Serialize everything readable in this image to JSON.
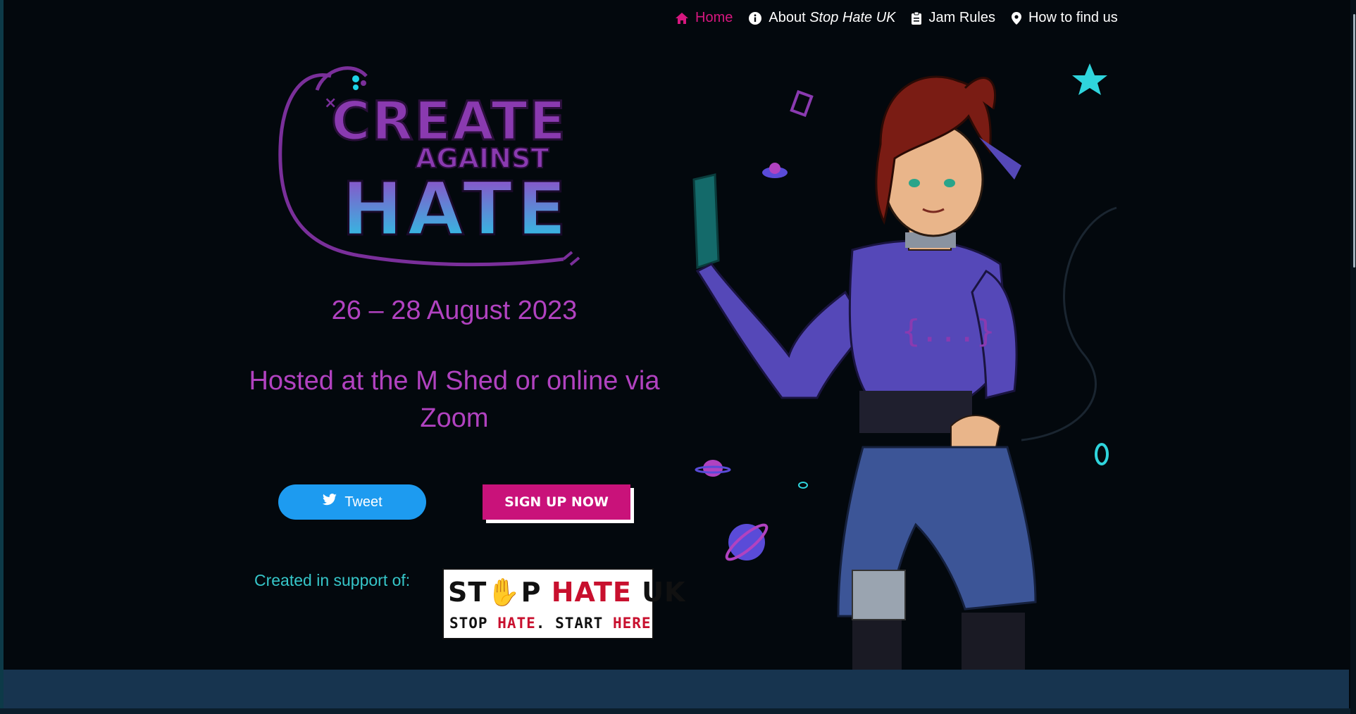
{
  "nav": {
    "items": [
      {
        "label": "Home",
        "icon": "home-icon",
        "active": true
      },
      {
        "label_prefix": "About ",
        "label_em": "Stop Hate UK",
        "icon": "info-icon"
      },
      {
        "label": "Jam Rules",
        "icon": "clipboard-icon"
      },
      {
        "label": "How to find us",
        "icon": "map-pin-icon"
      }
    ]
  },
  "logo": {
    "line1": "CREATE",
    "line2": "AGAINST",
    "line3": "HATE"
  },
  "event": {
    "date": "26 – 28 August 2023",
    "hosted": "Hosted at the M Shed or online via Zoom"
  },
  "buttons": {
    "tweet": "Tweet",
    "signup": "SIGN UP NOW"
  },
  "support": {
    "text": "Created in support of:",
    "partner_top_1": "ST",
    "partner_top_2": "P",
    "partner_top_red": "HATE",
    "partner_top_3": "UK",
    "partner_bottom_1": "STOP ",
    "partner_bottom_red": "HATE",
    "partner_bottom_2": ". START ",
    "partner_bottom_red2": "HERE"
  },
  "colors": {
    "accent": "#d6177f",
    "purple": "#b142c0",
    "teal": "#36c6c9",
    "twitter": "#1d9bf0"
  }
}
